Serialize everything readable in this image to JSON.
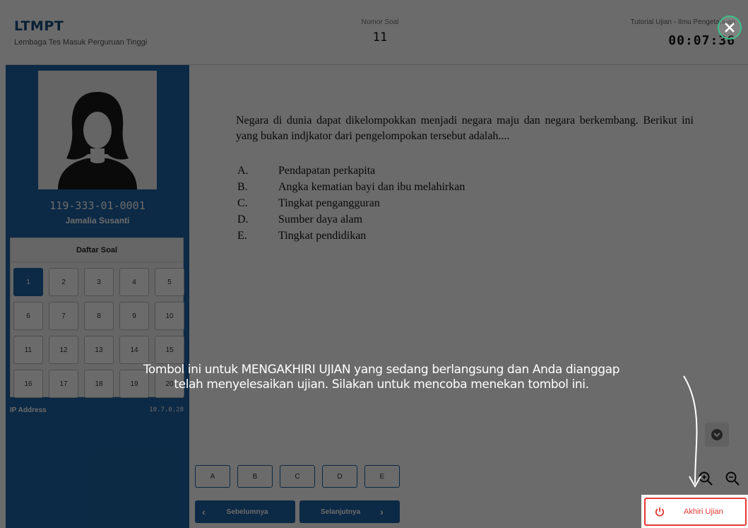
{
  "header": {
    "brand_title": "LTMPT",
    "brand_subtitle": "Lembaga Tes Masuk Perguruan Tinggi",
    "question_number_label": "Nomor Soal",
    "question_number": "11",
    "exam_title": "Tutorial Ujian - Ilmu Pengetahuan",
    "timer": "00:07:36"
  },
  "participant": {
    "id": "119-333-01-0001",
    "name": "Jamalia Susanti"
  },
  "question_list": {
    "title": "Daftar Soal",
    "items": [
      "1",
      "2",
      "3",
      "4",
      "5",
      "6",
      "7",
      "8",
      "9",
      "10",
      "11",
      "12",
      "13",
      "14",
      "15",
      "16",
      "17",
      "18",
      "19",
      "20"
    ],
    "active": "1"
  },
  "network": {
    "ip_label": "IP Address",
    "ip_value": "10.7.0.28"
  },
  "question": {
    "text": "Negara di dunia dapat dikelompokkan menjadi negara maju dan negara berkembang. Berikut ini yang bukan indjkator dari pengelompokan tersebut adalah....",
    "options": [
      {
        "letter": "A.",
        "text": "Pendapatan perkapita"
      },
      {
        "letter": "B.",
        "text": "Angka kematian bayi dan ibu melahirkan"
      },
      {
        "letter": "C.",
        "text": "Tingkat pengangguran"
      },
      {
        "letter": "D.",
        "text": "Sumber daya alam"
      },
      {
        "letter": "E.",
        "text": "Tingkat pendidikan"
      }
    ]
  },
  "answers": [
    "A",
    "B",
    "C",
    "D",
    "E"
  ],
  "navigation": {
    "prev_label": "Sebelumnya",
    "next_label": "Selanjutnya",
    "end_label": "Akhiri Ujian"
  },
  "tutorial": {
    "tip_line1": "Tombol ini untuk MENGAKHIRI UJIAN yang sedang berlangsung dan Anda dianggap",
    "tip_line2": "telah menyelesaikan ujian. Silakan untuk mencoba menekan tombol ini."
  },
  "colors": {
    "primary": "#1e63a4",
    "danger": "#e53935",
    "close_ring": "#3dbf8a"
  },
  "icons": {
    "close": "close-icon",
    "scroll_down": "chevron-down-icon",
    "zoom_in": "zoom-in-icon",
    "zoom_out": "zoom-out-icon",
    "power": "power-icon",
    "avatar": "user-avatar-icon"
  }
}
